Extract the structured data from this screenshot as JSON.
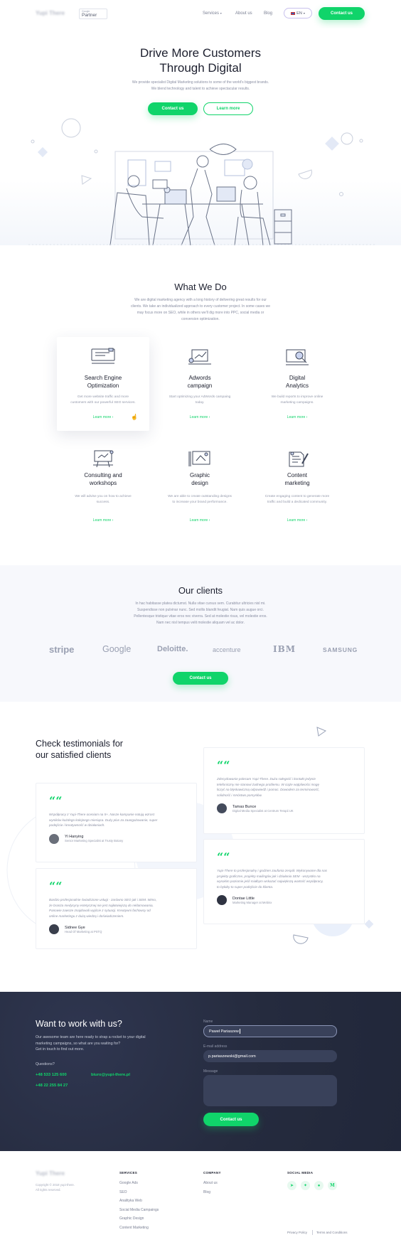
{
  "header": {
    "brand": "Yupi There",
    "partner_small": "Google",
    "partner": "Partner",
    "nav": [
      "Services",
      "About us",
      "Blog"
    ],
    "lang": "EN",
    "cta": "Contact us"
  },
  "hero": {
    "title_line1": "Drive More Customers",
    "title_line2": "Through Digital",
    "desc_line1": "We provide specialist Digital Marketing solutions to some of the world's biggest brands.",
    "desc_line2": "We blend technology and talent to achieve spectacular results.",
    "btn_primary": "Contact us",
    "btn_secondary": "Learn more"
  },
  "what": {
    "title": "What We Do",
    "desc": [
      "We are digital marketing agency with a long history of delivering great results for our",
      "clients. We take an individualized approach to every customer project. In some cases we",
      "may focus more on SEO, while in others we'll dig more into PPC, social media or",
      "conversion optimization."
    ],
    "cards": [
      {
        "title1": "Search Engine",
        "title2": "Optimization",
        "desc1": "Get more website traffic and more",
        "desc2": "customers with our powerful SEO services.",
        "more": "Learn more"
      },
      {
        "title1": "Adwords",
        "title2": "campaign",
        "desc1": "Start optimizing your AdWords campaing",
        "desc2": "today.",
        "more": "Learn more"
      },
      {
        "title1": "Digital",
        "title2": "Analytics",
        "desc1": "We build reports to improve online",
        "desc2": "marketing campaigns.",
        "more": "Learn more"
      },
      {
        "title1": "Consulting and",
        "title2": "workshops",
        "desc1": "We will advise you on how to achieve",
        "desc2": "success.",
        "more": "Learn more"
      },
      {
        "title1": "Graphic",
        "title2": "design",
        "desc1": "We are able to create outstanding designs",
        "desc2": "to increase your brand performance.",
        "more": "Learn more"
      },
      {
        "title1": "Content",
        "title2": "marketing",
        "desc1": "Create engaging content to generate more",
        "desc2": "traffic and build a dedicated community.",
        "more": "Learn more"
      }
    ]
  },
  "clients": {
    "title": "Our clients",
    "desc": [
      "In hac habitasse platea dictumst. Nulla vitae cursus sem. Curabitur ultricies nisl mi.",
      "Suspendisse non pulvinar nunc. Sed mollis blandit feugiat. Nam quis augue orci.",
      "Pellentesque tristique vitae eros nec viverra. Sed at molestie risus, vel molestie eros.",
      "Nam nec nisl tempus velit molestie aliquam vel ac dolor."
    ],
    "logos": [
      "stripe",
      "Google",
      "Deloitte.",
      "accenture",
      "IBM",
      "SAMSUNG"
    ],
    "cta": "Contact us"
  },
  "testimonials": {
    "title1": "Check testimonials for",
    "title2": "our satisfied clients",
    "quote_mark": "““",
    "items": [
      {
        "text": [
          "Zdecydowanie polecam Yupi-There. Duża sołegość i kontakt jedynie",
          "telefoniczny nie stanowi żadnego problemu. W ciąże wątpliwości mogę",
          "liczyć na błyskawiczną odpowiedź i pomoc. Dowodem za terminowość,",
          "solidność i mnóstwo pomysłów."
        ],
        "name": "Tamas Bunce",
        "role": "Digital Media Specialist at Centrum Terapii UK"
      },
      {
        "text": [
          "Współpracy z Yupi-There oceniam na 5+. Nasze kampanie notują wzrost",
          "wyników każdego kolejnego miesiąca. Duży plus za zaangażowanie, super",
          "podejście i kreatywność w działaniach."
        ],
        "name": "Yi Hanying",
        "role": "Senior Marketing Specialist at Trusty Botany"
      },
      {
        "text": [
          "Yupi-There to profesjonalny i godzien zaufania zespół. Wykonywane dla nas",
          "projekty graficzne, projekty mailingów jak i działania SEM - wszystko na",
          "wysokim poziomie jeśli miałbym wskazać największą wartość współpracy,",
          "to byłaby to super podejście do klienta."
        ],
        "name": "Dontae Little",
        "role": "Marketing Manager at Mebinx"
      },
      {
        "text": [
          "Bardzo profesjonalnie świadczone usługi - zarówno SEO jak i SEM. Mimo,",
          "że branża medycyny estetycznej nie jest najłatwiejszą do reklamowania,",
          "Panowie zawsze znajdowali wyjście z sytuacji. Kreatywni fachowcy od",
          "online marketingu z dużą wiedzą i doświadczeniem."
        ],
        "name": "Sidnee Gye",
        "role": "Head Of Marketing at PSTQ"
      }
    ]
  },
  "contact": {
    "title": "Want to work with us?",
    "desc": [
      "Our awesome team are here ready to strap a rocket to your digital",
      "marketing campaigns, so what are you waiting for?",
      "Get in touch to find out more."
    ],
    "questions": "Questions?",
    "phone1": "+48 533 125 600",
    "phone2": "+48 22 255 84 27",
    "email": "biuro@yupi-there.pl",
    "name_label": "Name",
    "name_value": "Paweł Pariaszew",
    "email_label": "E-mail address",
    "email_value": "p.pariaszewski@gmail.com",
    "message_label": "Message",
    "submit": "Contact us"
  },
  "footer": {
    "brand": "Yupi There",
    "copy1": "Copyright © 2018 yupi-there.",
    "copy2": "All rights reserved.",
    "services_h": "SERVICES",
    "services": [
      "Google Ads",
      "SEO",
      "Analityka Web",
      "Social Media Campaings",
      "Graphic Design",
      "Content Marketing"
    ],
    "company_h": "COMPANY",
    "company": [
      "About us",
      "Blog"
    ],
    "social_h": "SOCIAL MEDIA",
    "social": [
      "telegram-icon",
      "twitter-icon",
      "reddit-icon",
      "medium-icon"
    ],
    "privacy": "Privacy Policy",
    "terms": "Terms and Conditions"
  },
  "colors": {
    "accent": "#10d46a",
    "dark": "#262c40",
    "text": "#1c1f2e"
  }
}
